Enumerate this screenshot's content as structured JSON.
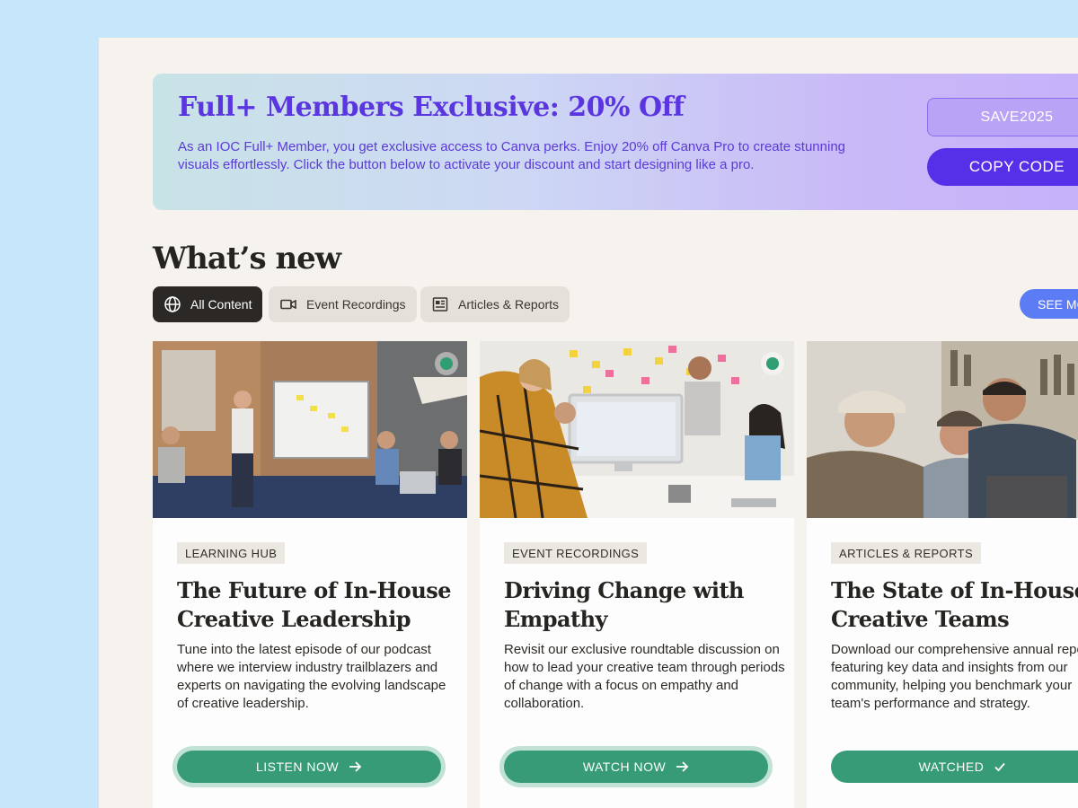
{
  "promo": {
    "title": "Full+ Members Exclusive: 20% Off",
    "text": "As an IOC Full+ Member, you get exclusive access to Canva perks. Enjoy 20% off Canva Pro to create stunning visuals effortlessly. Click the button below to activate your discount and start designing like a pro.",
    "code": "SAVE2025",
    "copy_label": "COPY CODE"
  },
  "section": {
    "title": "What’s new",
    "see_more_label": "SEE MO"
  },
  "tabs": [
    {
      "label": "All Content",
      "icon": "globe-icon",
      "active": true
    },
    {
      "label": "Event Recordings",
      "icon": "video-camera-icon",
      "active": false
    },
    {
      "label": "Articles & Reports",
      "icon": "article-icon",
      "active": false
    }
  ],
  "cards": [
    {
      "badge": "LEARNING HUB",
      "title": "The Future of In-House Creative Leadership",
      "description": "Tune into the latest episode of our podcast where we interview industry trailblazers and experts on navigating the evolving landscape of creative leadership.",
      "cta": "LISTEN NOW",
      "cta_icon": "arrow-right-icon",
      "image": "photo-team-whiteboard-presentation"
    },
    {
      "badge": "EVENT RECORDINGS",
      "title": "Driving Change with Empathy",
      "description": "Revisit our exclusive roundtable discussion on how to lead your creative team through periods of change with a focus on empathy and collaboration.",
      "cta": "WATCH NOW",
      "cta_icon": "arrow-right-icon",
      "image": "photo-team-at-monitor-sticky-notes"
    },
    {
      "badge": "ARTICLES & REPORTS",
      "title": "The State of In-House Creative Teams",
      "description": "Download our comprehensive annual report featuring key data and insights from our community, helping you benchmark your team's performance and strategy.",
      "cta": "WATCHED",
      "cta_icon": "checkmark-icon",
      "image": "photo-team-laughing-laptop"
    }
  ],
  "colors": {
    "accent_purple": "#5530e8",
    "cta_green": "#369b76",
    "see_more_blue": "#5b7cf5",
    "page_bg": "#f6f3ee",
    "outer_bg": "#c6e6fb"
  }
}
